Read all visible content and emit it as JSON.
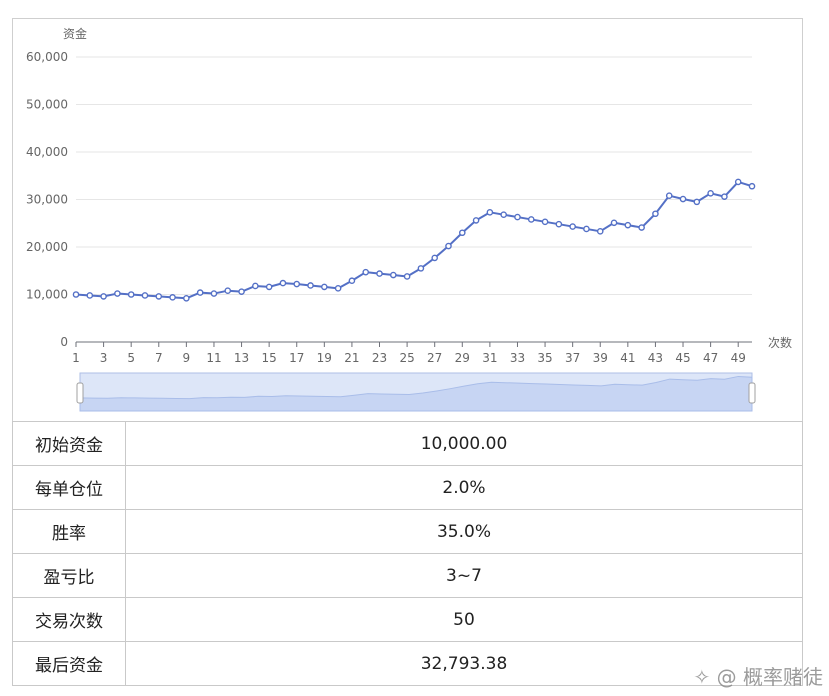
{
  "chart_data": {
    "type": "line",
    "ylabel": "资金",
    "xlabel": "次数",
    "ylim": [
      0,
      60000
    ],
    "yticks": [
      0,
      10000,
      20000,
      30000,
      40000,
      50000,
      60000
    ],
    "ytick_labels": [
      "0",
      "10,000",
      "20,000",
      "30,000",
      "40,000",
      "50,000",
      "60,000"
    ],
    "x": [
      1,
      2,
      3,
      4,
      5,
      6,
      7,
      8,
      9,
      10,
      11,
      12,
      13,
      14,
      15,
      16,
      17,
      18,
      19,
      20,
      21,
      22,
      23,
      24,
      25,
      26,
      27,
      28,
      29,
      30,
      31,
      32,
      33,
      34,
      35,
      36,
      37,
      38,
      39,
      40,
      41,
      42,
      43,
      44,
      45,
      46,
      47,
      48,
      49,
      50
    ],
    "xtick_labels": [
      "1",
      "3",
      "5",
      "7",
      "9",
      "11",
      "13",
      "15",
      "17",
      "19",
      "21",
      "23",
      "25",
      "27",
      "29",
      "31",
      "33",
      "35",
      "37",
      "39",
      "41",
      "43",
      "45",
      "47",
      "49"
    ],
    "series": [
      {
        "color": "#5470c6",
        "values": [
          10000,
          9800,
          9600,
          10200,
          10000,
          9800,
          9600,
          9400,
          9200,
          10400,
          10200,
          10800,
          10600,
          11800,
          11600,
          12400,
          12200,
          11900,
          11600,
          11300,
          12900,
          14700,
          14400,
          14100,
          13800,
          15500,
          17700,
          20200,
          23000,
          25600,
          27300,
          26800,
          26300,
          25800,
          25300,
          24800,
          24300,
          23800,
          23300,
          25100,
          24600,
          24100,
          27000,
          30800,
          30100,
          29500,
          31300,
          30600,
          33700,
          32793.38
        ]
      }
    ],
    "grid": true,
    "dataZoom": true
  },
  "table": {
    "rows": [
      {
        "label": "初始资金",
        "value": "10,000.00"
      },
      {
        "label": "每单仓位",
        "value": "2.0%"
      },
      {
        "label": "胜率",
        "value": "35.0%"
      },
      {
        "label": "盈亏比",
        "value": "3~7"
      },
      {
        "label": "交易次数",
        "value": "50"
      },
      {
        "label": "最后资金",
        "value": "32,793.38"
      }
    ]
  },
  "watermark": "@ 概率赌徒",
  "colors": {
    "line": "#5470c6",
    "zoom_fill": "#dde6f8",
    "zoom_border": "#aebfe6"
  }
}
